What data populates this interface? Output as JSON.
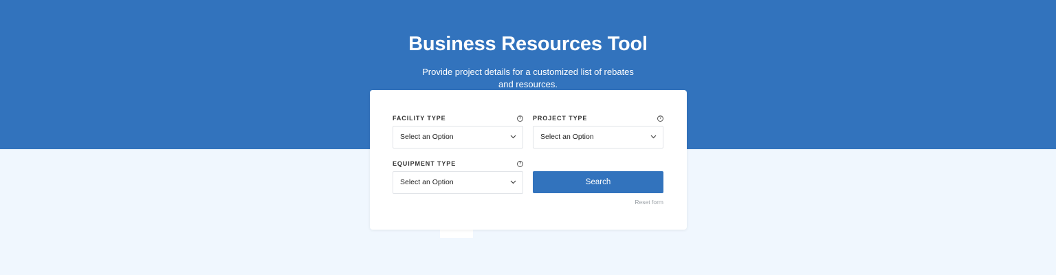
{
  "hero": {
    "title": "Business Resources Tool",
    "subtitle": "Provide project details for a customized list of rebates and resources."
  },
  "form": {
    "facility": {
      "label": "FACILITY TYPE",
      "help_icon": "question-circle-icon",
      "value": "Select an Option"
    },
    "project": {
      "label": "PROJECT TYPE",
      "help_icon": "question-circle-icon",
      "value": "Select an Option"
    },
    "equipment": {
      "label": "EQUIPMENT TYPE",
      "help_icon": "question-circle-icon",
      "value": "Select an Option"
    },
    "search_label": "Search",
    "reset_label": "Reset form",
    "help_glyph": "?"
  },
  "colors": {
    "brand": "#3273bd",
    "page_background": "#f0f7fe",
    "card": "#ffffff"
  }
}
